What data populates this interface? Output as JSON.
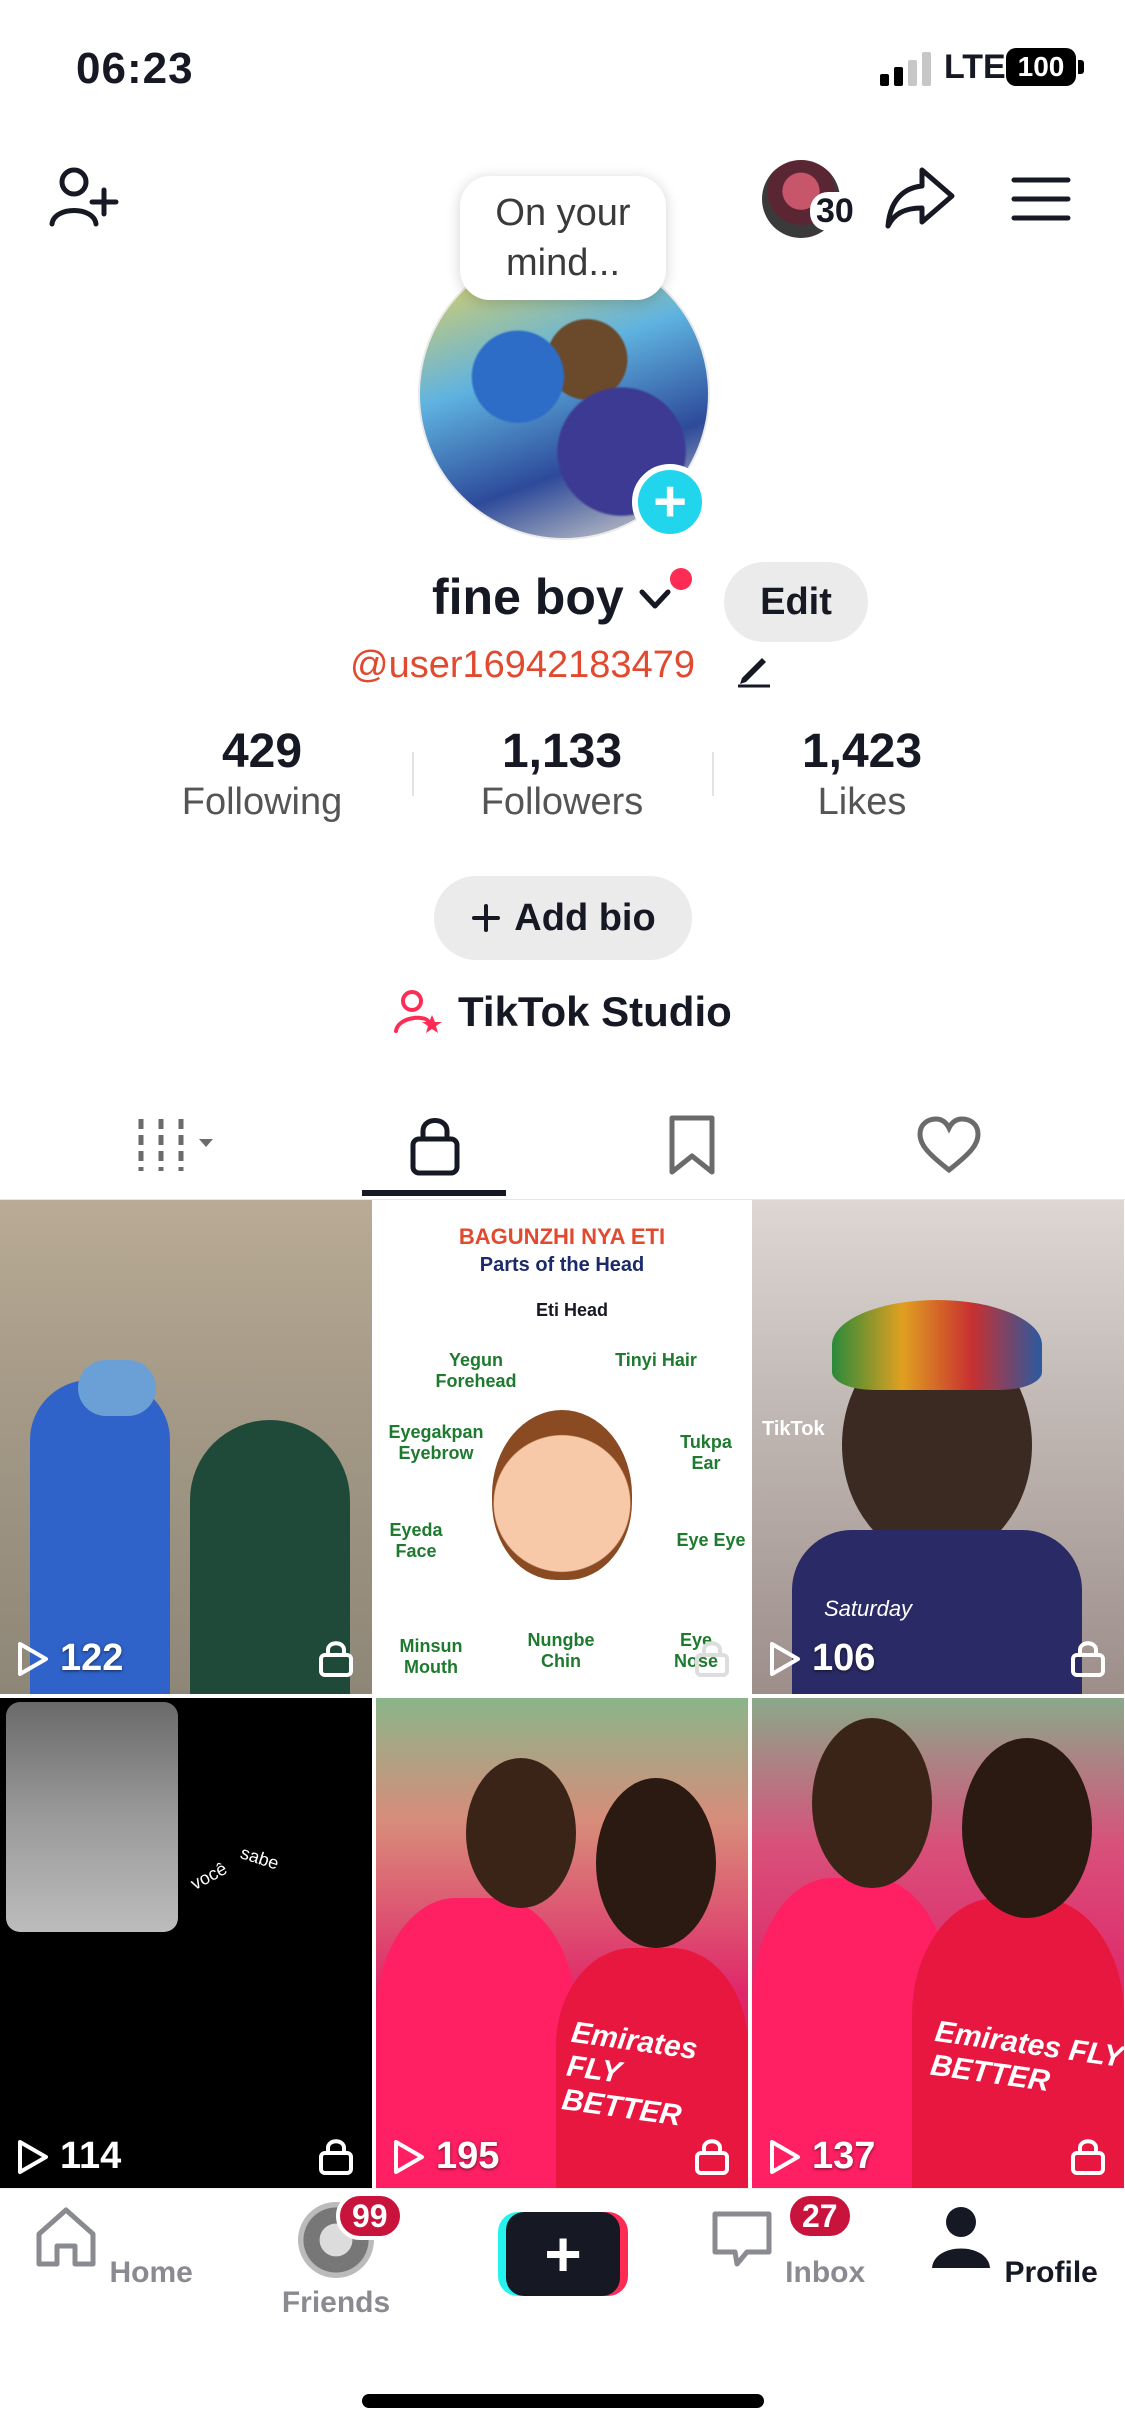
{
  "status_bar": {
    "time": "06:23",
    "network": "LTE",
    "battery": "100"
  },
  "top_nav": {
    "avatar_count": "30"
  },
  "profile": {
    "mind_prompt": "On your mind...",
    "display_name": "fine boy",
    "edit_label": "Edit",
    "username": "@user16942183479",
    "stats": [
      {
        "value": "429",
        "label": "Following"
      },
      {
        "value": "1,133",
        "label": "Followers"
      },
      {
        "value": "1,423",
        "label": "Likes"
      }
    ],
    "add_bio_label": "Add bio",
    "studio_label": "TikTok Studio"
  },
  "tabs": [
    "videos",
    "private",
    "favorites",
    "liked"
  ],
  "grid": [
    {
      "views": "122"
    },
    {
      "views": "",
      "title": "BAGUNZHI NYA ETI",
      "subtitle": "Parts of the Head",
      "labels": [
        "Eti Head",
        "Yegun Forehead",
        "Tinyi Hair",
        "Eyegakpan Eyebrow",
        "Tukpa Ear",
        "Eyeda Face",
        "Eye Eye",
        "Minsun Mouth",
        "Nungbe Chin",
        "Eye Nose"
      ]
    },
    {
      "views": "106",
      "overlay": "TikTok",
      "caption": "Saturday"
    },
    {
      "views": "114",
      "text1": "você",
      "text2": "sabe"
    },
    {
      "views": "195",
      "shirt": "Emirates FLY BETTER"
    },
    {
      "views": "137",
      "shirt": "Emirates FLY BETTER"
    }
  ],
  "bottom_nav": {
    "home": "Home",
    "friends": "Friends",
    "friends_badge": "99",
    "inbox": "Inbox",
    "inbox_badge": "27",
    "profile": "Profile"
  },
  "colors": {
    "accent": "#fe2c55",
    "cyan": "#20d5ec",
    "username": "#e24a30",
    "badge": "#c8143c"
  }
}
